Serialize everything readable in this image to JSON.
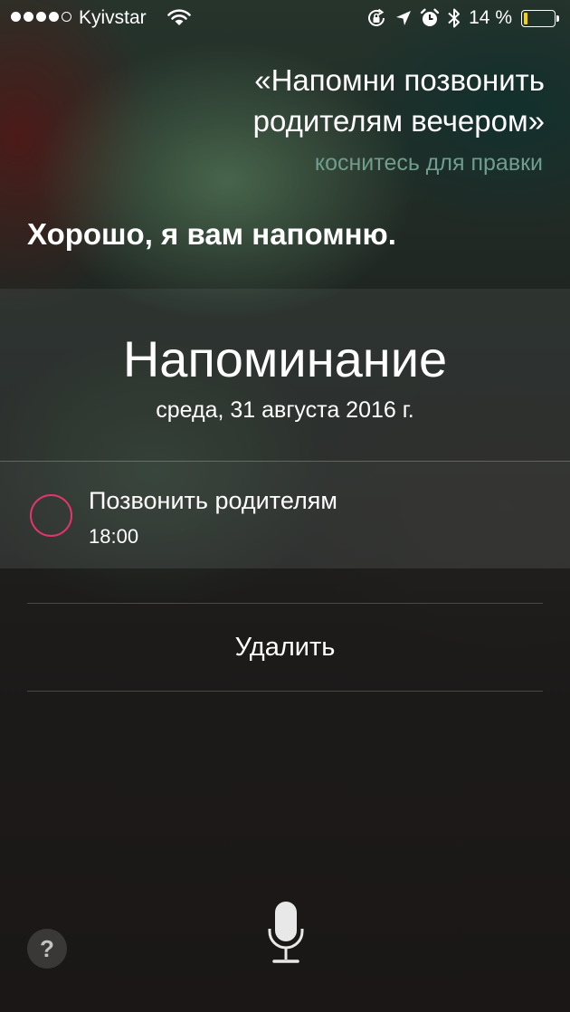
{
  "status_bar": {
    "signal_bars_filled": 4,
    "signal_bars_total": 5,
    "carrier": "Kyivstar",
    "battery_percent_label": "14 %",
    "battery_level": 0.14,
    "battery_fill_color": "#f5d10a",
    "icons": [
      "wifi-icon",
      "rotation-lock-icon",
      "location-arrow-icon",
      "alarm-clock-icon",
      "bluetooth-icon",
      "battery-icon"
    ]
  },
  "siri": {
    "user_query": "«Напомни позвонить родителям вечером»",
    "edit_hint": "коснитесь для правки",
    "response": "Хорошо, я вам напомню."
  },
  "card": {
    "title": "Напоминание",
    "date": "среда, 31 августа 2016 г.",
    "reminder": {
      "title": "Позвонить родителям",
      "time": "18:00",
      "checkbox_color": "#e2366a",
      "completed": false
    }
  },
  "actions": {
    "delete_label": "Удалить"
  },
  "bottom": {
    "help_label": "?",
    "mic_icon": "microphone-icon"
  }
}
